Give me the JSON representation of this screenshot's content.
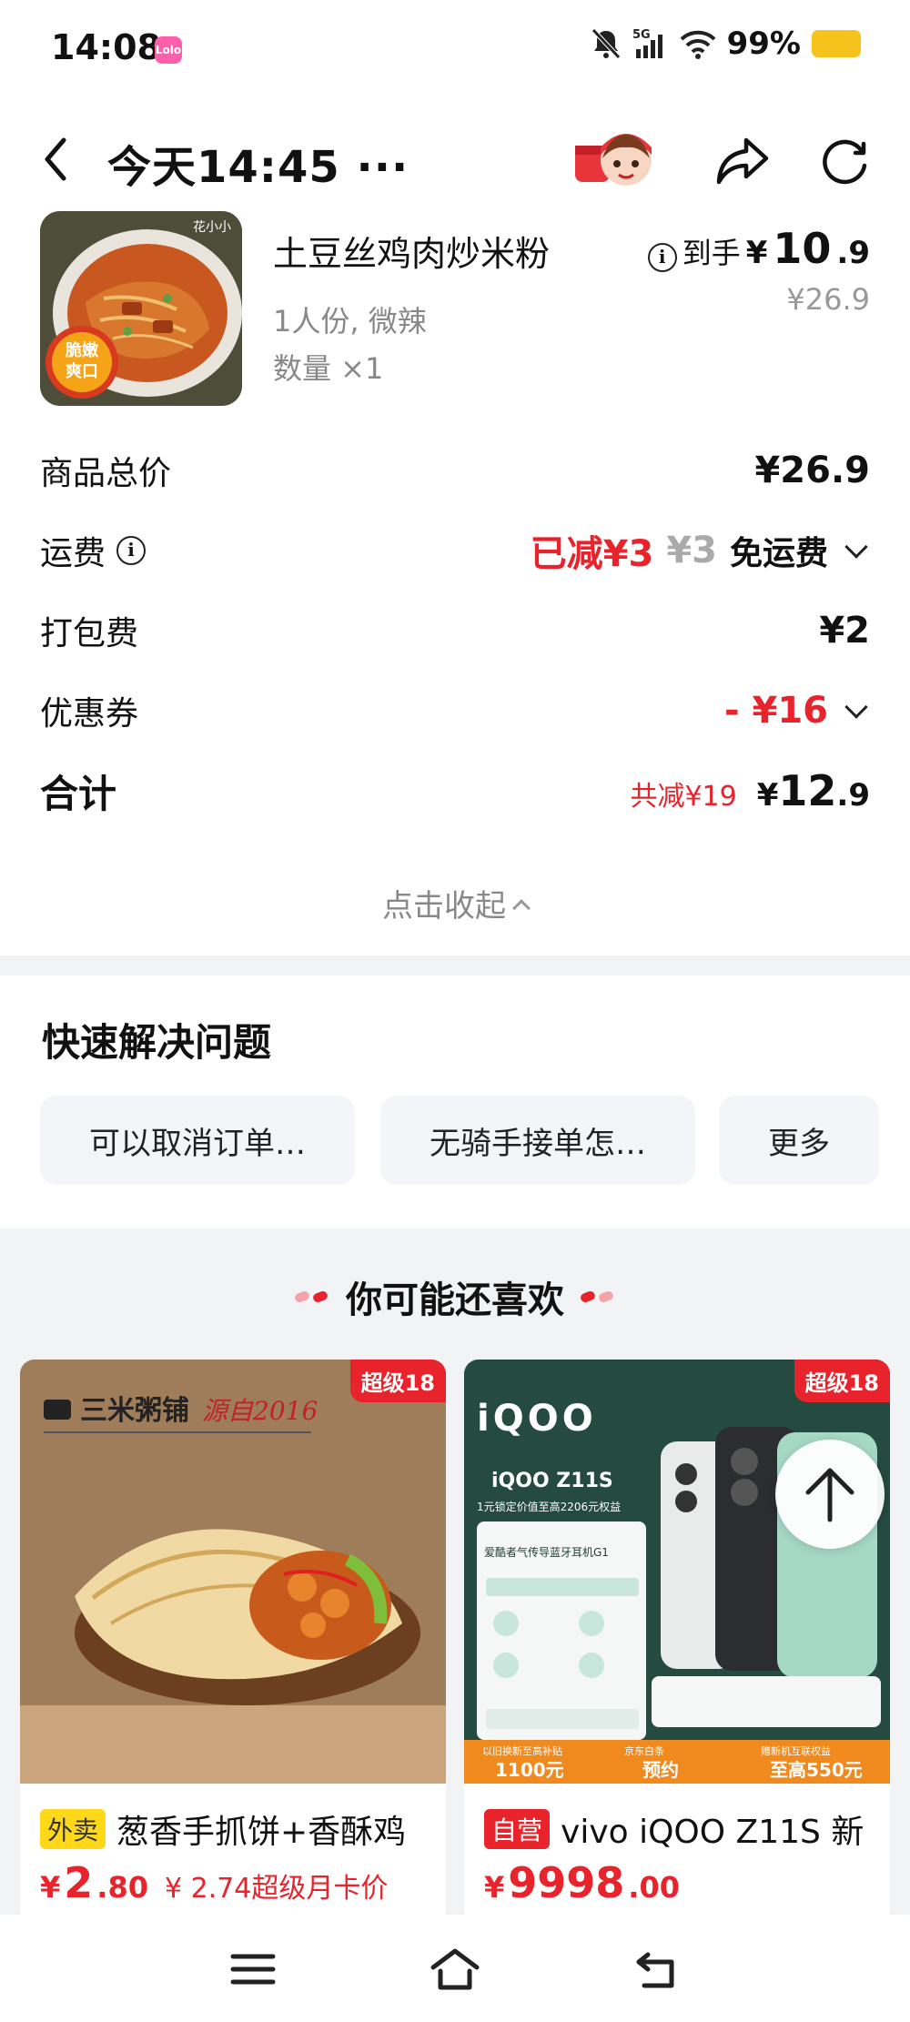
{
  "status_bar": {
    "time": "14:08",
    "app_badge": "Lolo",
    "network": "5G",
    "battery": "99%",
    "battery_color": "#f6c21c"
  },
  "nav": {
    "title": "今天14:45 ···",
    "back_icon": "back-arrow-icon",
    "share_icon": "share-icon",
    "refresh_icon": "refresh-icon"
  },
  "order": {
    "item_name": "土豆丝鸡肉炒米粉",
    "item_spec": "1人份, 微辣",
    "item_qty": "数量 ×1",
    "img_brand": "花小小",
    "img_sticker": "脆嫩爽口",
    "price_label": "到手",
    "price_currency": "¥",
    "price_int": "10",
    "price_dec": ".9",
    "price_original": "¥26.9",
    "rows": {
      "subtotal_label": "商品总价",
      "subtotal_value": "¥26.9",
      "delivery_label": "运费",
      "delivery_reduced": "已减¥3",
      "delivery_original": "¥3",
      "delivery_free": "免运费",
      "packing_label": "打包费",
      "packing_value": "¥2",
      "coupon_label": "优惠券",
      "coupon_value": "- ¥16",
      "total_label": "合计",
      "total_reduced": "共减¥19",
      "total_currency": "¥",
      "total_int": "12",
      "total_dec": ".9"
    },
    "collapse_label": "点击收起"
  },
  "quick": {
    "title": "快速解决问题",
    "chips": [
      "可以取消订单…",
      "无骑手接单怎…",
      "更多"
    ]
  },
  "recommend": {
    "title": "你可能还喜欢",
    "cards": [
      {
        "badge": "超级18",
        "tag": "外卖",
        "title": "葱香手抓饼+香酥鸡",
        "price_currency": "¥",
        "price_int": "2",
        "price_dec": ".80",
        "extra": "¥ 2.74超级月卡价",
        "img_brand": "三米粥铺",
        "img_slogan": "源自2016"
      },
      {
        "badge": "超级18",
        "tag": "自营",
        "title": "vivo iQOO Z11S 新",
        "price_currency": "¥",
        "price_int": "9998",
        "price_dec": ".00",
        "extra": "",
        "img_brand": "iQOO",
        "img_model": "iQOO Z11S",
        "img_line1": "1元锁定价值至高2206元权益",
        "img_line2": "爱酷者气传导蓝牙耳机G1",
        "img_bar": [
          "以旧换新至高补贴",
          "京东白条",
          "赠新机互联权益"
        ],
        "img_bar_values": [
          "1100元",
          "预约",
          "至高550元"
        ]
      }
    ]
  },
  "accent_red": "#e8232b"
}
